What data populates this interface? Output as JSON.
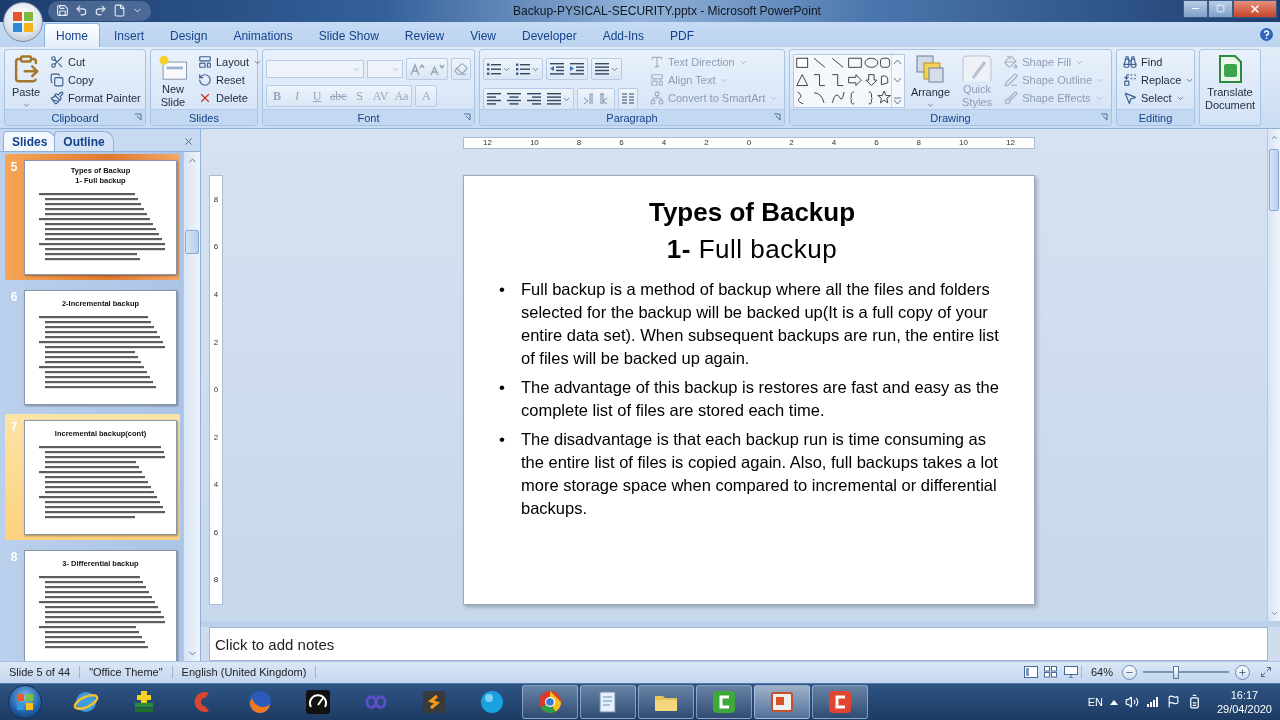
{
  "window": {
    "title": "Backup-PYSICAL-SECURITY.pptx - Microsoft PowerPoint"
  },
  "tabs": [
    {
      "label": "Home",
      "selected": true
    },
    {
      "label": "Insert",
      "selected": false
    },
    {
      "label": "Design",
      "selected": false
    },
    {
      "label": "Animations",
      "selected": false
    },
    {
      "label": "Slide Show",
      "selected": false
    },
    {
      "label": "Review",
      "selected": false
    },
    {
      "label": "View",
      "selected": false
    },
    {
      "label": "Developer",
      "selected": false
    },
    {
      "label": "Add-Ins",
      "selected": false
    },
    {
      "label": "PDF",
      "selected": false
    }
  ],
  "ribbon": {
    "clipboard": {
      "label": "Clipboard",
      "paste": "Paste",
      "items": [
        "Cut",
        "Copy",
        "Format Painter"
      ]
    },
    "slides": {
      "label": "Slides",
      "new_slide": "New Slide",
      "items": [
        "Layout",
        "Reset",
        "Delete"
      ]
    },
    "font": {
      "label": "Font",
      "disabled": true,
      "buttons": [
        "B",
        "I",
        "U",
        "abc",
        "S",
        "AV",
        "Aa",
        "A"
      ]
    },
    "paragraph": {
      "label": "Paragraph",
      "items": [
        {
          "label": "Text Direction",
          "disabled": true
        },
        {
          "label": "Align Text",
          "disabled": true
        },
        {
          "label": "Convert to SmartArt",
          "disabled": true
        }
      ]
    },
    "drawing": {
      "label": "Drawing",
      "arrange": "Arrange",
      "quick_styles": {
        "label": "Quick Styles",
        "disabled": true
      },
      "items": [
        {
          "label": "Shape Fill",
          "disabled": true
        },
        {
          "label": "Shape Outline",
          "disabled": true
        },
        {
          "label": "Shape Effects",
          "disabled": true
        }
      ]
    },
    "editing": {
      "label": "Editing",
      "items": [
        "Find",
        "Replace",
        "Select"
      ]
    },
    "translate": {
      "label": "Translate Document"
    }
  },
  "panel_tabs": [
    {
      "label": "Slides",
      "selected": true
    },
    {
      "label": "Outline",
      "selected": false
    }
  ],
  "slides": [
    {
      "number": "5",
      "title": "Types of Backup",
      "subtitle": "1- Full backup",
      "selected": true,
      "hovered": false
    },
    {
      "number": "6",
      "title": "2-Incremental backup",
      "selected": false,
      "hovered": false
    },
    {
      "number": "7",
      "title": "Incremental backup(cont)",
      "selected": false,
      "hovered": true
    },
    {
      "number": "8",
      "title": "3- Differential backup",
      "selected": false,
      "hovered": false
    }
  ],
  "horizontal_ruler": [
    "12",
    "10",
    "8",
    "6",
    "4",
    "2",
    "0",
    "2",
    "4",
    "6",
    "8",
    "10",
    "12"
  ],
  "vertical_ruler": [
    "8",
    "6",
    "4",
    "2",
    "0",
    "2",
    "4",
    "6",
    "8"
  ],
  "slide": {
    "title": "Types of Backup",
    "subtitle": "**1-** Full backup",
    "bullets": [
      {
        "marker": "•",
        "text": "Full backup is a method of backup where all the files and folders selected for the backup will be backed up(It is a full copy of your entire data set).  When subsequent backups are run, the entire list of files will be backed up again."
      },
      {
        "marker": "•",
        "text": "The advantage of this backup is restores are fast and easy as the complete list of files are stored each time."
      },
      {
        "marker": "•",
        "text": "The disadvantage is that each backup run is time consuming as the entire list of files is copied again.  Also, full backups takes a lot more storage space when compared to incremental or differential backups."
      }
    ]
  },
  "notes": {
    "text": "Click to add notes"
  },
  "status_bar": {
    "slide": "Slide 5 of 44",
    "theme": "\"Office Theme\"",
    "language": "English (United Kingdom)",
    "zoom": "64%",
    "zoom_slider": {
      "level": 0.38
    }
  },
  "taskbar": {
    "apps": [
      {
        "running": false,
        "active": false
      },
      {
        "running": false,
        "active": false
      },
      {
        "running": false,
        "active": false
      },
      {
        "running": false,
        "active": false
      },
      {
        "running": false,
        "active": false
      },
      {
        "running": false,
        "active": false
      },
      {
        "running": false,
        "active": false
      },
      {
        "running": false,
        "active": false
      },
      {
        "running": true,
        "active": false
      },
      {
        "running": true,
        "active": false
      },
      {
        "running": true,
        "active": false
      },
      {
        "running": true,
        "active": false
      },
      {
        "running": true,
        "active": true
      },
      {
        "running": true,
        "active": false
      }
    ],
    "language": "EN",
    "time": "16:17",
    "date": "29/04/2020"
  }
}
